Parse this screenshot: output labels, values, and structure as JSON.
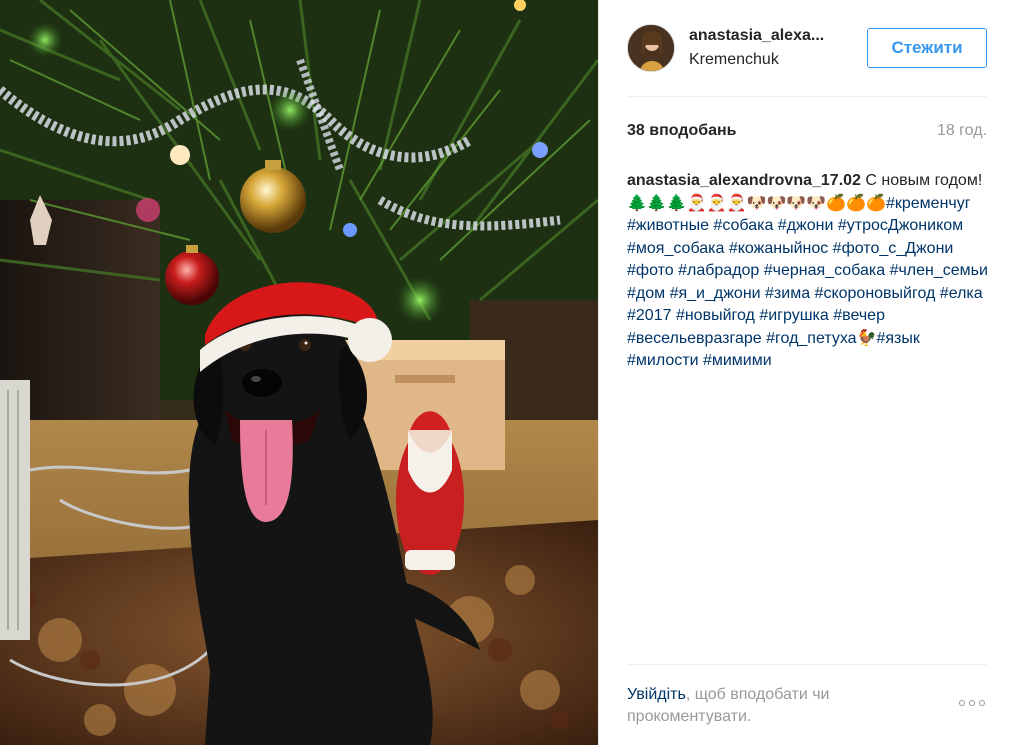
{
  "post": {
    "header": {
      "username": "anastasia_alexa...",
      "location": "Kremenchuk",
      "follow_label": "Стежити"
    },
    "stats": {
      "likes": "38 вподобань",
      "time_ago": "18 год."
    },
    "caption": {
      "username": "anastasia_alexandrovna_17.02",
      "text_start": " С новым годом!",
      "emoji_line": "🌲🌲🌲🎅🎅🎅🐶🐶🐶🐶🍊🍊🍊",
      "hashtags": "#кременчуг #животные #собака #джони #утросДжоником #моя_собака #кожаныйнос #фото_с_Джони #фото #лабрадор #черная_собака #член_семьи #дом #я_и_джони #зима #скороновыйгод #елка #2017 #новыйгод #игрушка #вечер #весельевразгаре #год_петуха🐓#язык #милости #мимими"
    },
    "footer": {
      "login_link": "Увійдіть",
      "login_rest": ", щоб вподобати чи прокоментувати."
    },
    "icons": {
      "more": "more-options-icon"
    },
    "colors": {
      "accent": "#3897f0",
      "hashtag": "#003569",
      "muted": "#999999",
      "text": "#262626"
    }
  }
}
